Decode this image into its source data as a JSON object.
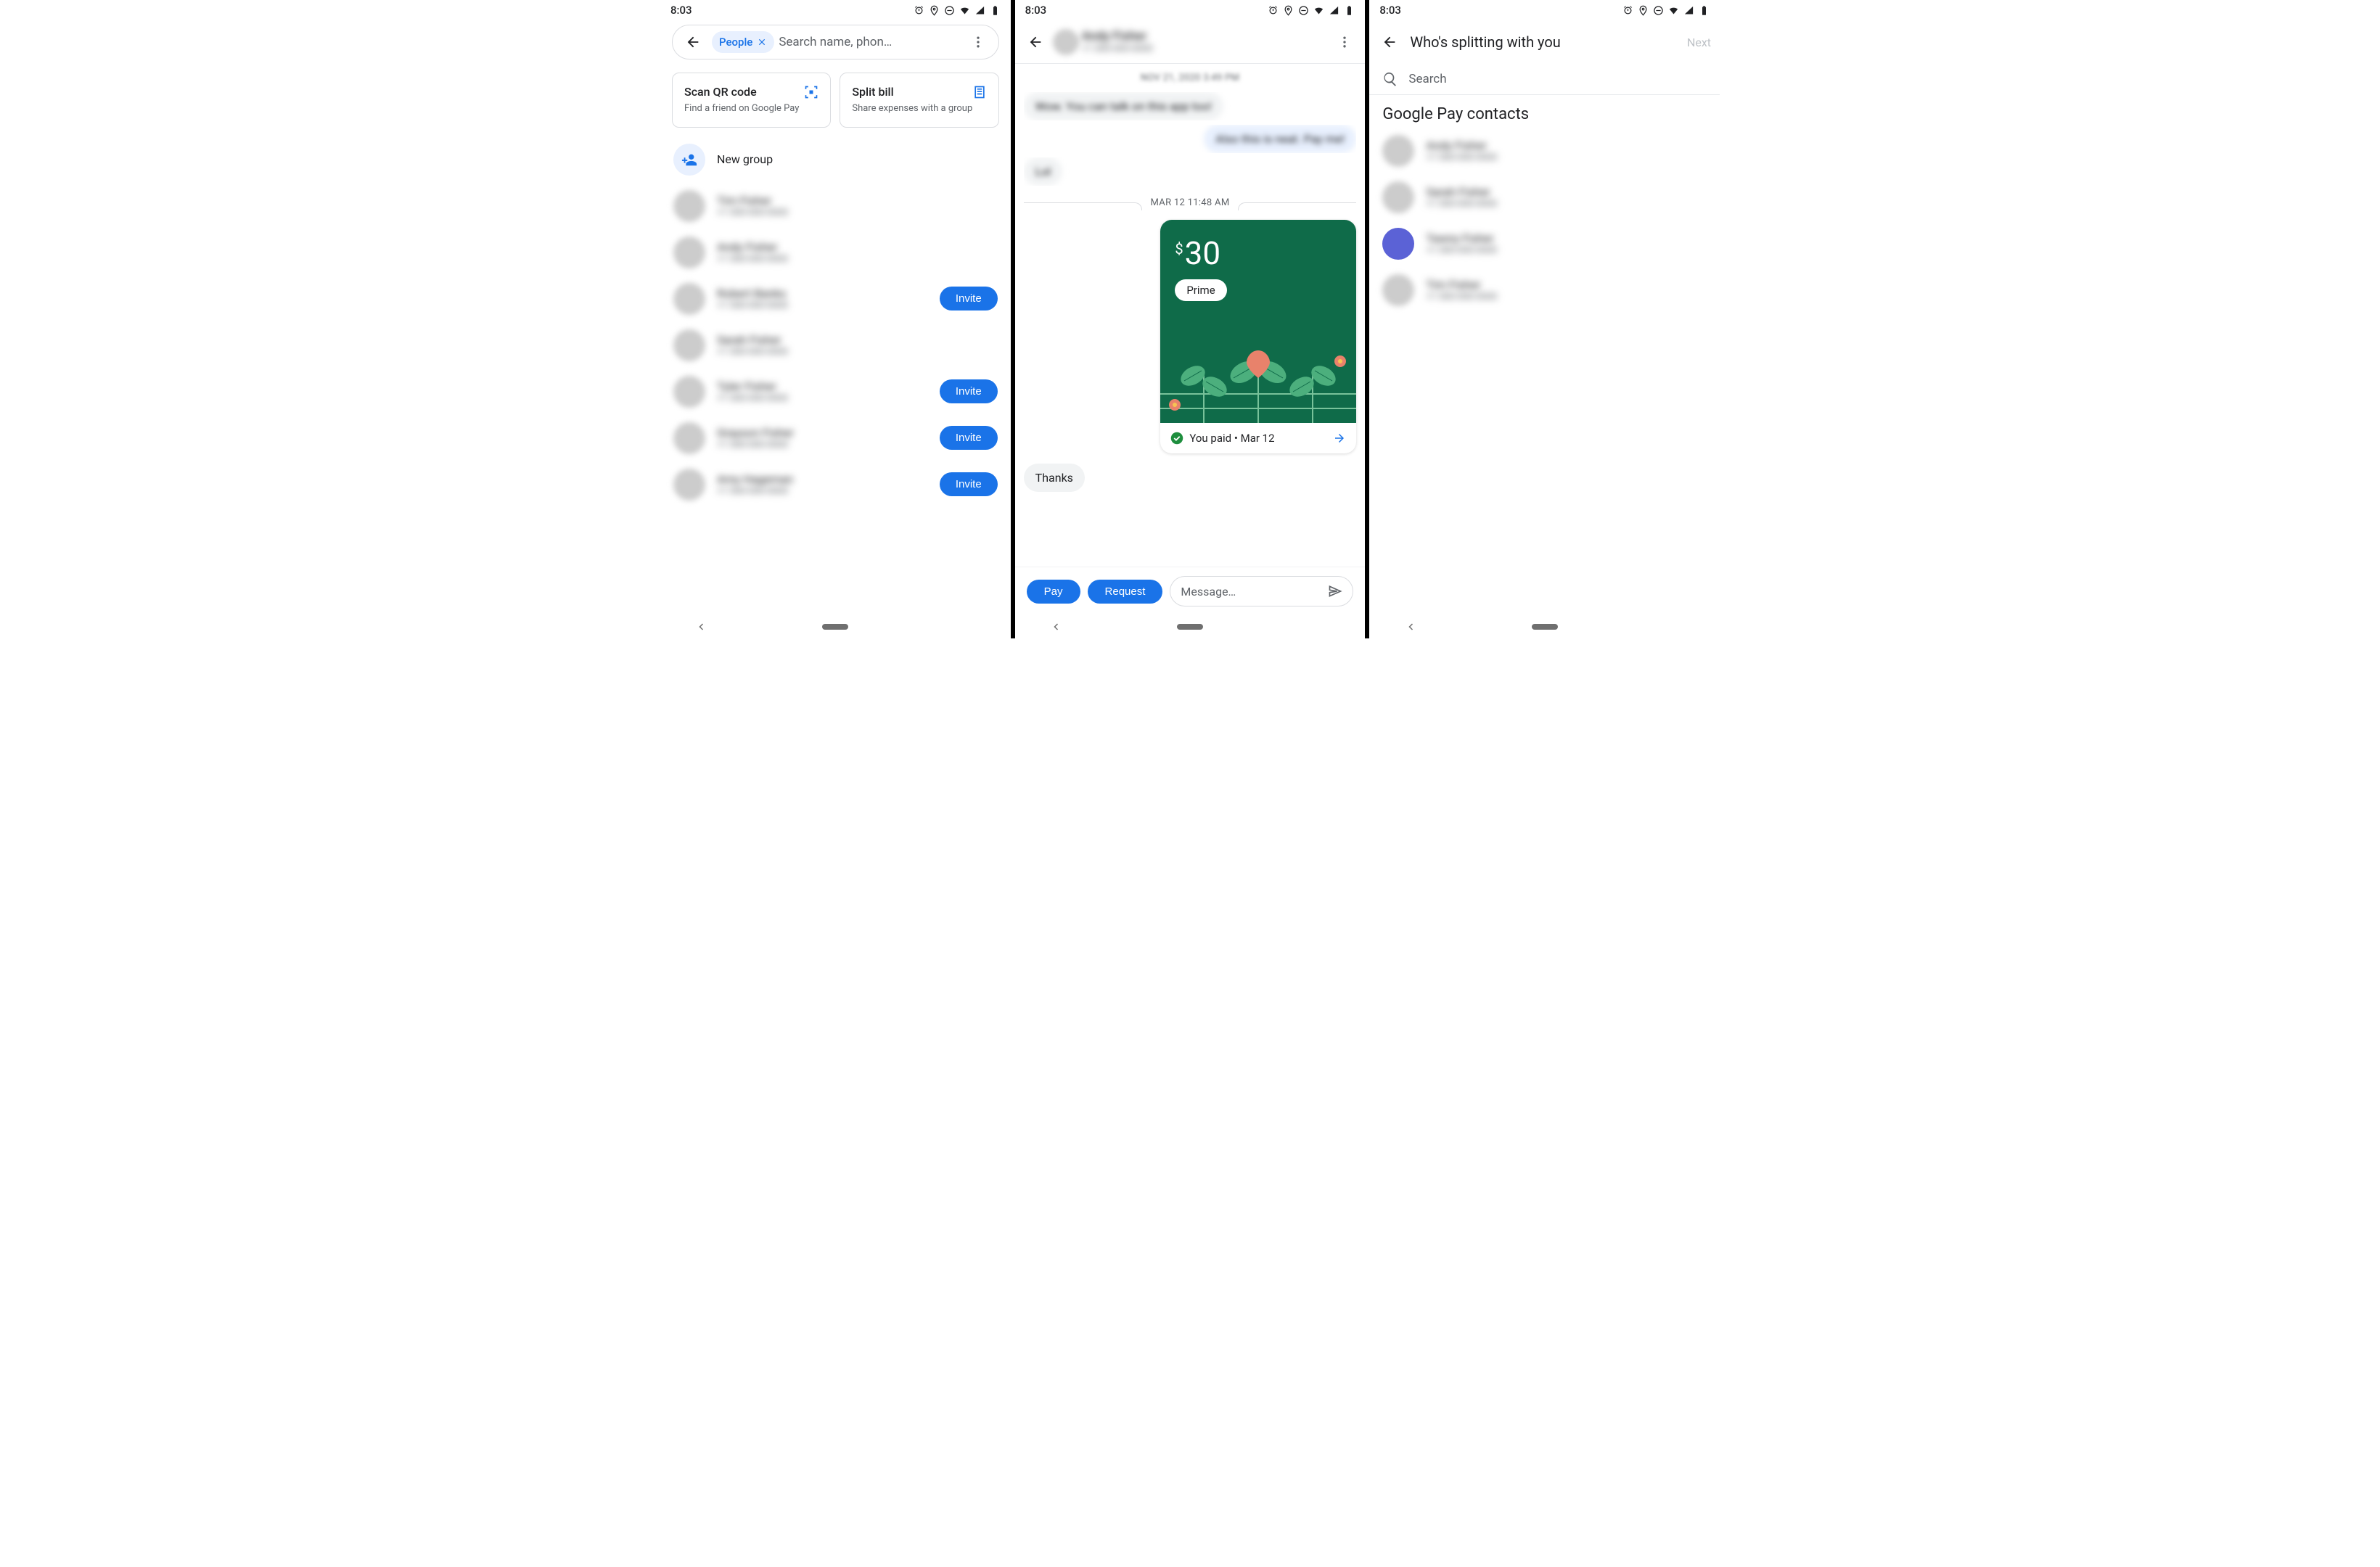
{
  "status": {
    "time": "8:03"
  },
  "screen1": {
    "chip": "People",
    "search_placeholder": "Search name, phon…",
    "card_qr": {
      "title": "Scan QR code",
      "sub": "Find a friend on Google Pay"
    },
    "card_split": {
      "title": "Split bill",
      "sub": "Share expenses with a group"
    },
    "new_group": "New group",
    "invite": "Invite",
    "contacts": [
      {
        "name": "Tim Fisher",
        "sub": "+1 000-000-0000",
        "invite": false
      },
      {
        "name": "Andy Fisher",
        "sub": "+1 000-000-0000",
        "invite": false
      },
      {
        "name": "Robert Banks",
        "sub": "+1 000-000-0000",
        "invite": true
      },
      {
        "name": "Sarah Fisher",
        "sub": "+1 000-000-0000",
        "invite": false
      },
      {
        "name": "Tyler Fisher",
        "sub": "+1 000-000-0000",
        "invite": true
      },
      {
        "name": "Grayson Fisher",
        "sub": "+1 000-000-0000",
        "invite": true
      },
      {
        "name": "Amy Hageman",
        "sub": "+1 000-000-0000",
        "invite": true
      }
    ]
  },
  "screen2": {
    "contact_name": "Andy Fisher",
    "contact_sub": "+1 000-000-0000",
    "date_prev": "NOV 21, 2020 3:49 PM",
    "msg_in_1": "Wow. You can talk on this app too!",
    "msg_out_1": "Also this is neat. Pay me!",
    "msg_in_2": "Lol",
    "date": "MAR 12 11:48 AM",
    "amount": "30",
    "currency": "$",
    "tag": "Prime",
    "status": "You paid • Mar 12",
    "suggestion": "Thanks",
    "pay": "Pay",
    "request": "Request",
    "message_placeholder": "Message…"
  },
  "screen3": {
    "title": "Who's splitting with you",
    "next": "Next",
    "search": "Search",
    "section": "Google Pay contacts",
    "contacts": [
      {
        "name": "Andy Fisher",
        "sub": "+1 000-000-0000"
      },
      {
        "name": "Sarah Fisher",
        "sub": "+1 000-000-0000"
      },
      {
        "name": "Tawny Fisher",
        "sub": "+1 000-000-0000"
      },
      {
        "name": "Tim Fisher",
        "sub": "+1 000-000-0000"
      }
    ]
  }
}
